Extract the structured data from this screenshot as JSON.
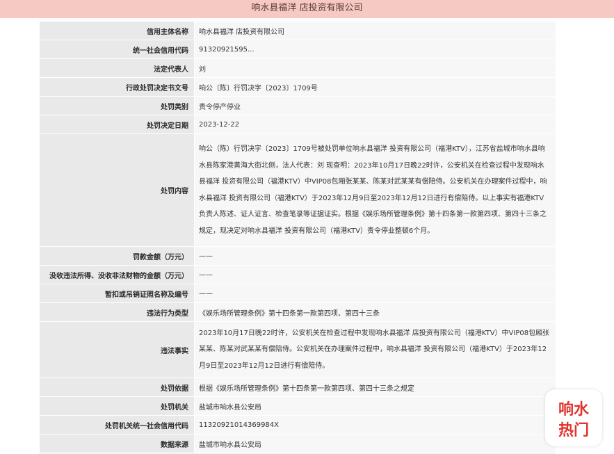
{
  "page": {
    "title": "响水县福洋    店投资有限公司"
  },
  "rows": [
    {
      "label": "信用主体名称",
      "value": "响水县福洋    店投资有限公司"
    },
    {
      "label": "统一社会信用代码",
      "value": "91320921595..."
    },
    {
      "label": "法定代表人",
      "value": "刘"
    },
    {
      "label": "行政处罚决定书文号",
      "value": "响公〔陈〕行罚决字〔2023〕1709号"
    },
    {
      "label": "处罚类别",
      "value": "责令停产停业"
    },
    {
      "label": "处罚决定日期",
      "value": "2023-12-22"
    },
    {
      "label": "处罚内容",
      "value": "响公（陈）行罚决字〔2023〕1709号被处罚单位响水县福洋    投资有限公司（福港KTV），江苏省盐城市响水县响水县陈家港黄海大街北侧，法人代表：刘       现查明：2023年10月17日晚22时许，公安机关在检查过程中发现响水县福洋       投资有限公司（福港KTV）中VIP08包厢张某某、陈某对武某某有偿陪侍。公安机关在办理案件过程中，响水县福洋   投资有限公司（福港KTV）于2023年12月9日至2023年12月12日进行有偿陪侍。以上事实有福港KTV负责人陈述、证人证言、检查笔录等证据证实。根据《娱乐场所管理条例》第十四条第一款第四项、第四十三条之规定，现决定对响水县福洋      投资有限公司（福港KTV）责令停业整顿6个月。"
    },
    {
      "label": "罚款金额（万元）",
      "value": "——"
    },
    {
      "label": "没收违法所得、没收非法财物的金额（万元）",
      "value": "——"
    },
    {
      "label": "暂扣或吊销证照名称及编号",
      "value": "——"
    },
    {
      "label": "违法行为类型",
      "value": "《娱乐场所管理条例》第十四条第一款第四项、第四十三条"
    },
    {
      "label": "违法事实",
      "value": "2023年10月17日晚22时许，公安机关在检查过程中发现响水县福洋   店投资有限公司（福港KTV）中VIP08包厢张某某、陈某对武某某有偿陪侍。公安机关在办理案件过程中，响水县福洋    投资有限公司（福港KTV）于2023年12月9日至2023年12月12日进行有偿陪侍。"
    },
    {
      "label": "处罚依据",
      "value": "根据《娱乐场所管理条例》第十四条第一款第四项、第四十三条之规定"
    },
    {
      "label": "处罚机关",
      "value": "盐城市响水县公安局"
    },
    {
      "label": "处罚机关统一社会信用代码",
      "value": "11320921014369984X"
    },
    {
      "label": "数据来源",
      "value": "盐城市响水县公安局"
    }
  ],
  "watermark": {
    "text_top": "响水",
    "text_bottom": "热门",
    "color": "#e0342c"
  }
}
